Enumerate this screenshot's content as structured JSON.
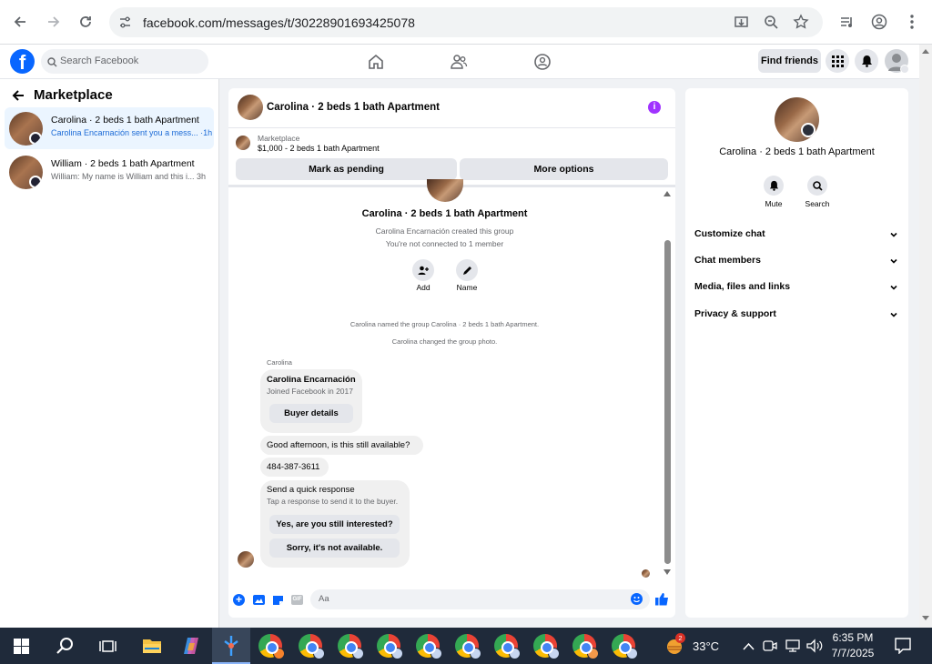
{
  "browser": {
    "url": "facebook.com/messages/t/30228901693425078"
  },
  "fb": {
    "search_placeholder": "Search Facebook",
    "find_friends": "Find friends"
  },
  "left": {
    "title": "Marketplace",
    "conversations": [
      {
        "name": "Carolina · 2 beds 1 bath Apartment",
        "preview": "Carolina Encarnación sent you a mess... ·1h"
      },
      {
        "name": "William · 2 beds 1 bath Apartment",
        "preview": "William: My name is William and this i... 3h"
      }
    ]
  },
  "chat": {
    "title": "Carolina · 2 beds 1 bath Apartment",
    "listing_source": "Marketplace",
    "listing_price": "$1,000 - 2 beds 1 bath Apartment",
    "mark_pending": "Mark as pending",
    "more_options": "More options",
    "group_name": "Carolina · 2 beds 1 bath Apartment",
    "created_by": "Carolina Encarnación created this group",
    "not_connected": "You're not connected to 1 member",
    "add_label": "Add",
    "name_label": "Name",
    "event1": "Carolina named the group Carolina · 2 beds 1 bath Apartment.",
    "event2": "Carolina changed the group photo.",
    "sender": "Carolina",
    "card_name": "Carolina Encarnación",
    "card_joined": "Joined Facebook in 2017",
    "buyer_details": "Buyer details",
    "msg1": "Good afternoon, is this still available?",
    "msg2": "484-387-3611",
    "quick_title": "Send a quick response",
    "quick_sub": "Tap a response to send it to the buyer.",
    "quick_opt1": "Yes, are you still interested?",
    "quick_opt2": "Sorry, it's not available.",
    "input_placeholder": "Aa",
    "gif_label": "GIF"
  },
  "right": {
    "title": "Carolina · 2 beds 1 bath Apartment",
    "mute": "Mute",
    "search": "Search",
    "sections": [
      "Customize chat",
      "Chat members",
      "Media, files and links",
      "Privacy & support"
    ]
  },
  "taskbar": {
    "weather_temp": "33°C",
    "weather_badge": "2",
    "time": "6:35 PM",
    "date": "7/7/2025"
  },
  "colors": {
    "fb_blue": "#0866ff",
    "info_purple": "#a033ff",
    "taskbar": "#1f2a3a"
  }
}
